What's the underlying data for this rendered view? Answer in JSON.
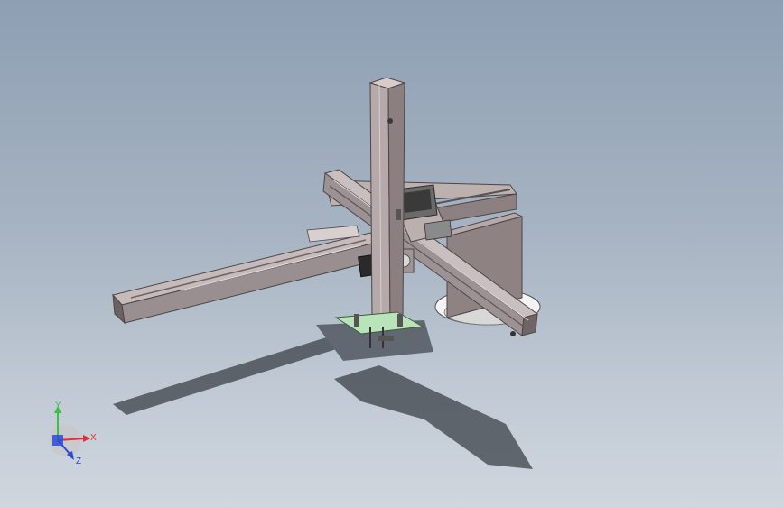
{
  "triad": {
    "x_label": "X",
    "y_label": "Y",
    "z_label": "Z",
    "x_color": "#e0322e",
    "y_color": "#3dbf4a",
    "z_color": "#2a4bd6"
  },
  "model": {
    "beam_color": "#b8aaa8",
    "beam_dark": "#6f6566",
    "plate_color": "#b8e3b8",
    "motor_color": "#2a2a2a",
    "shadow_color": "#3a3f46"
  }
}
